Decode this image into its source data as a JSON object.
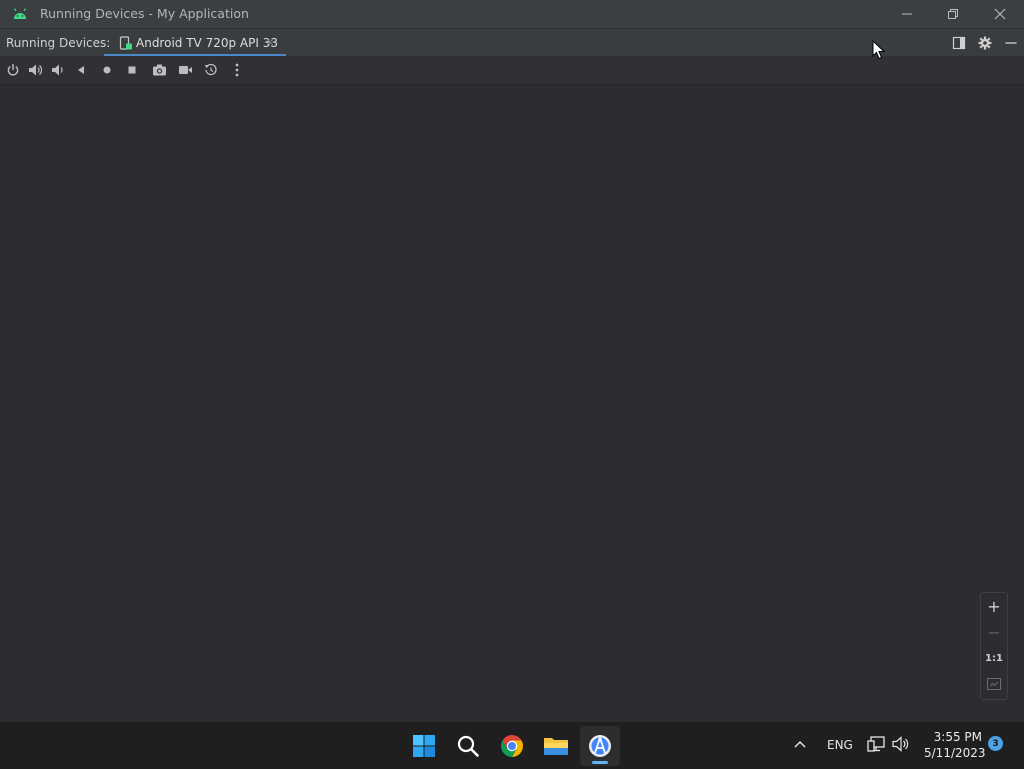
{
  "window": {
    "title": "Running Devices - My Application",
    "app_icon": "android-icon",
    "controls": [
      "minimize-icon",
      "restore-icon",
      "close-icon"
    ]
  },
  "tabbar": {
    "label": "Running Devices:",
    "tabs": [
      {
        "label": "Android TV 720p API 33",
        "icon": "device-icon",
        "close": "×",
        "active": true
      }
    ],
    "right_tools": [
      "layout-icon",
      "gear-icon",
      "hide-icon"
    ]
  },
  "toolbar": {
    "buttons": [
      "power-icon",
      "volume-up-icon",
      "volume-down-icon",
      "back-icon",
      "home-icon",
      "overview-icon",
      "screenshot-icon",
      "screen-record-icon",
      "snapshot-icon",
      "more-icon"
    ]
  },
  "zoom": {
    "zoom_in": "+",
    "zoom_out": "−",
    "actual_size": "1:1",
    "fit": "fit-screen-icon"
  },
  "taskbar": {
    "apps": [
      "windows-start-icon",
      "search-icon",
      "chrome-icon",
      "file-explorer-icon",
      "android-studio-icon"
    ],
    "active_app": "android-studio-icon",
    "tray": {
      "chevron": "chevron-up-icon",
      "language": "ENG",
      "network": "network-icon",
      "volume": "volume-icon"
    },
    "clock": {
      "time": "3:55 PM",
      "date": "5/11/2023"
    },
    "notification_count": "3"
  },
  "colors": {
    "accent": "#4a88c7",
    "android_green": "#3ddc84",
    "background": "#2b2d30"
  }
}
